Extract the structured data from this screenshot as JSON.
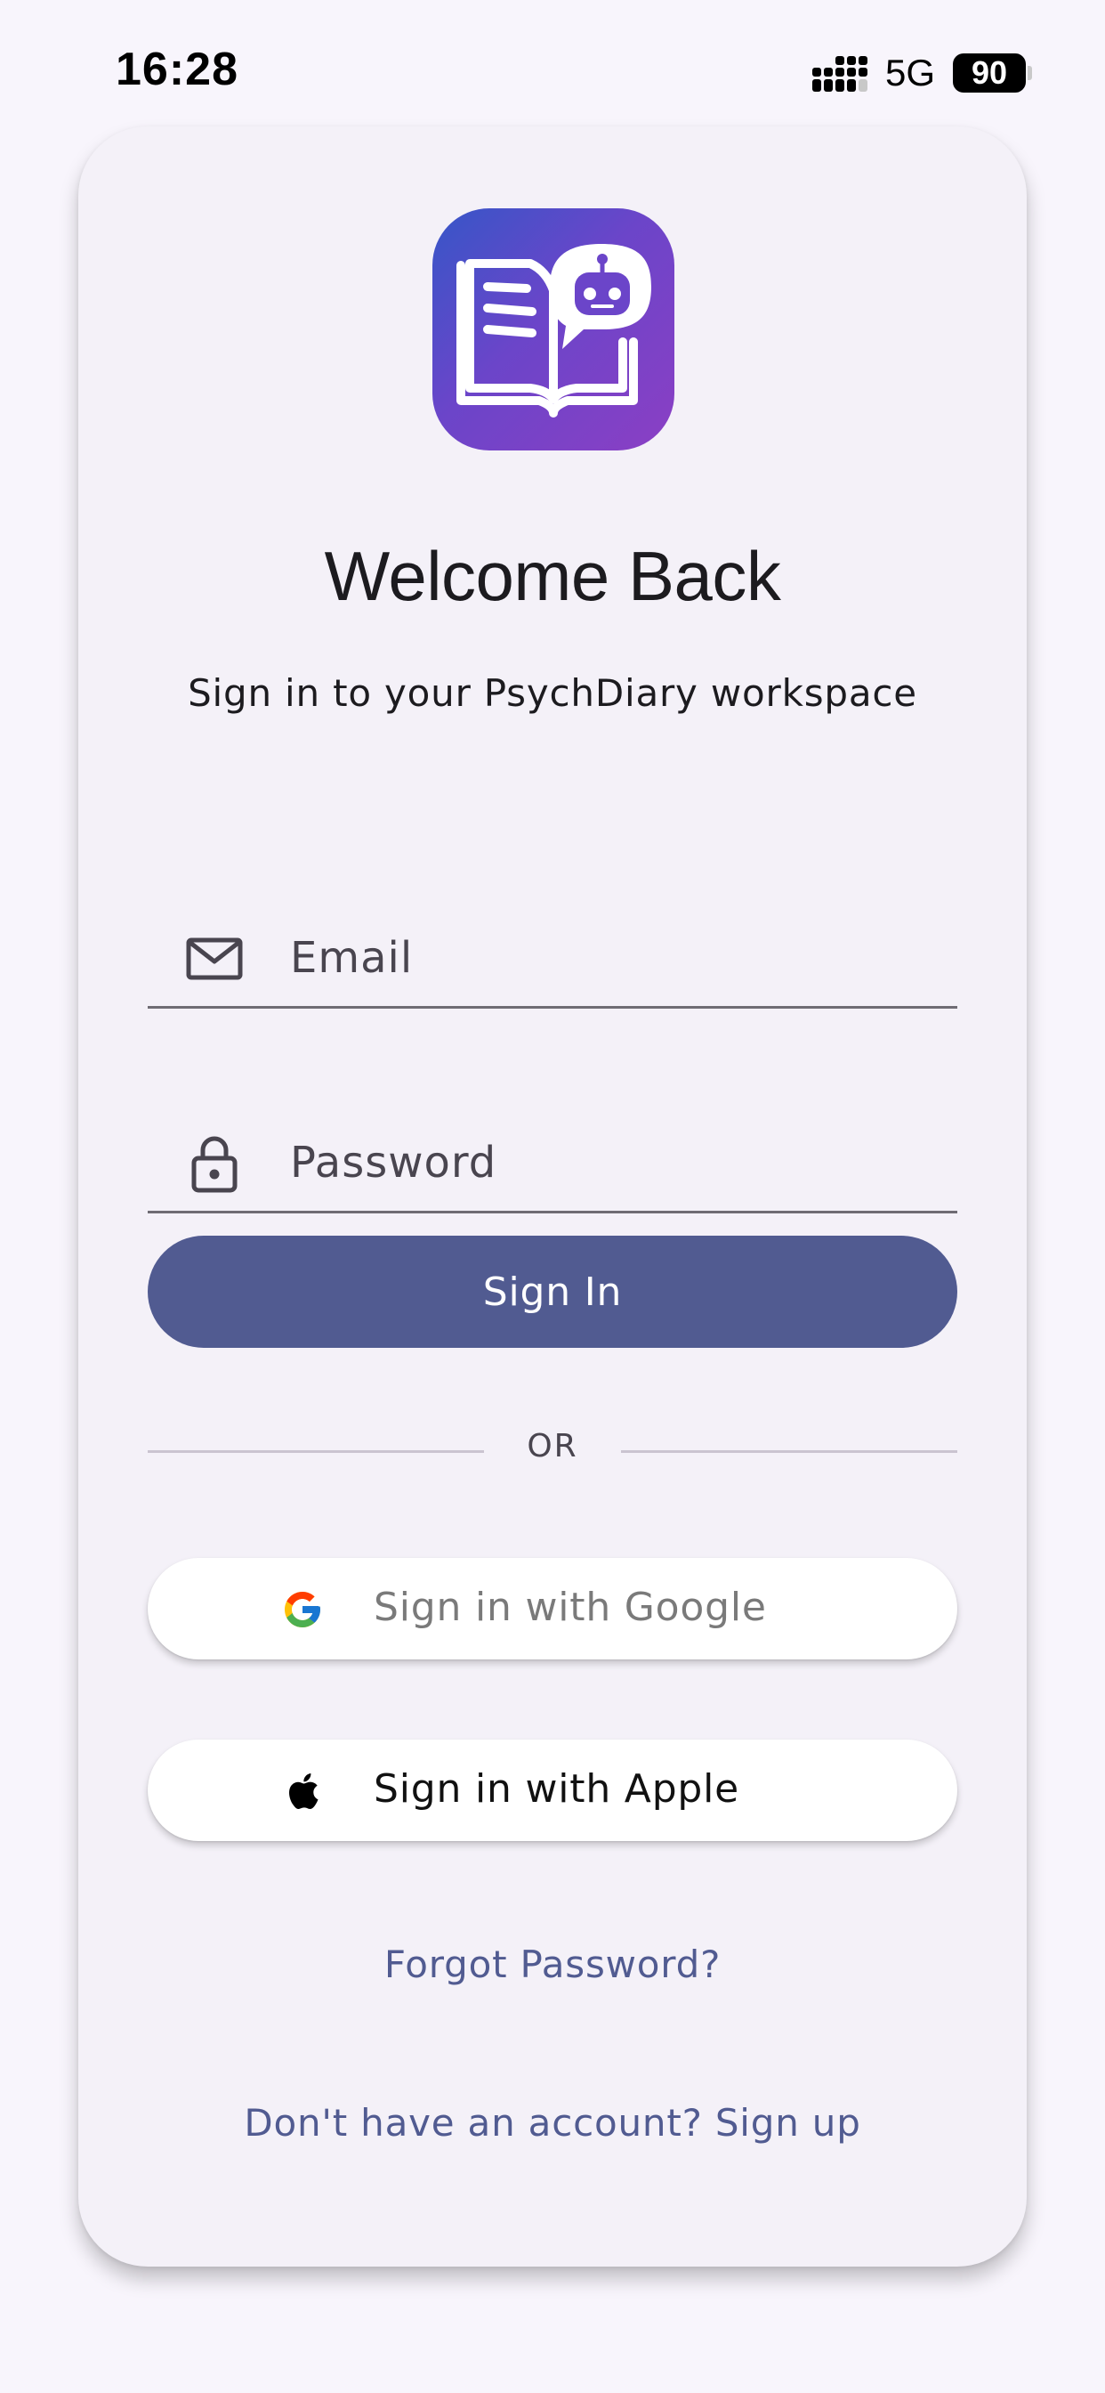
{
  "status_bar": {
    "time": "16:28",
    "network": "5G",
    "battery": "90"
  },
  "login": {
    "title": "Welcome Back",
    "subtitle": "Sign in to your PsychDiary workspace",
    "email_placeholder": "Email",
    "email_value": "",
    "password_placeholder": "Password",
    "password_value": "",
    "sign_in_label": "Sign In",
    "divider_text": "OR",
    "google_label": "Sign in with Google",
    "apple_label": "Sign in with Apple",
    "forgot_password": "Forgot Password?",
    "signup_prompt": "Don't have an account? Sign up"
  },
  "icons": {
    "logo": "book-chatbot-icon",
    "email": "mail-icon",
    "password": "lock-icon",
    "google": "google-icon",
    "apple": "apple-icon"
  },
  "colors": {
    "background": "#f8f5fc",
    "card": "#f4f1f8",
    "primary": "#515b91",
    "logo_gradient_start": "#3656c8",
    "logo_gradient_end": "#8b3fc4",
    "text": "#1c1b1f",
    "link": "#515b91"
  }
}
